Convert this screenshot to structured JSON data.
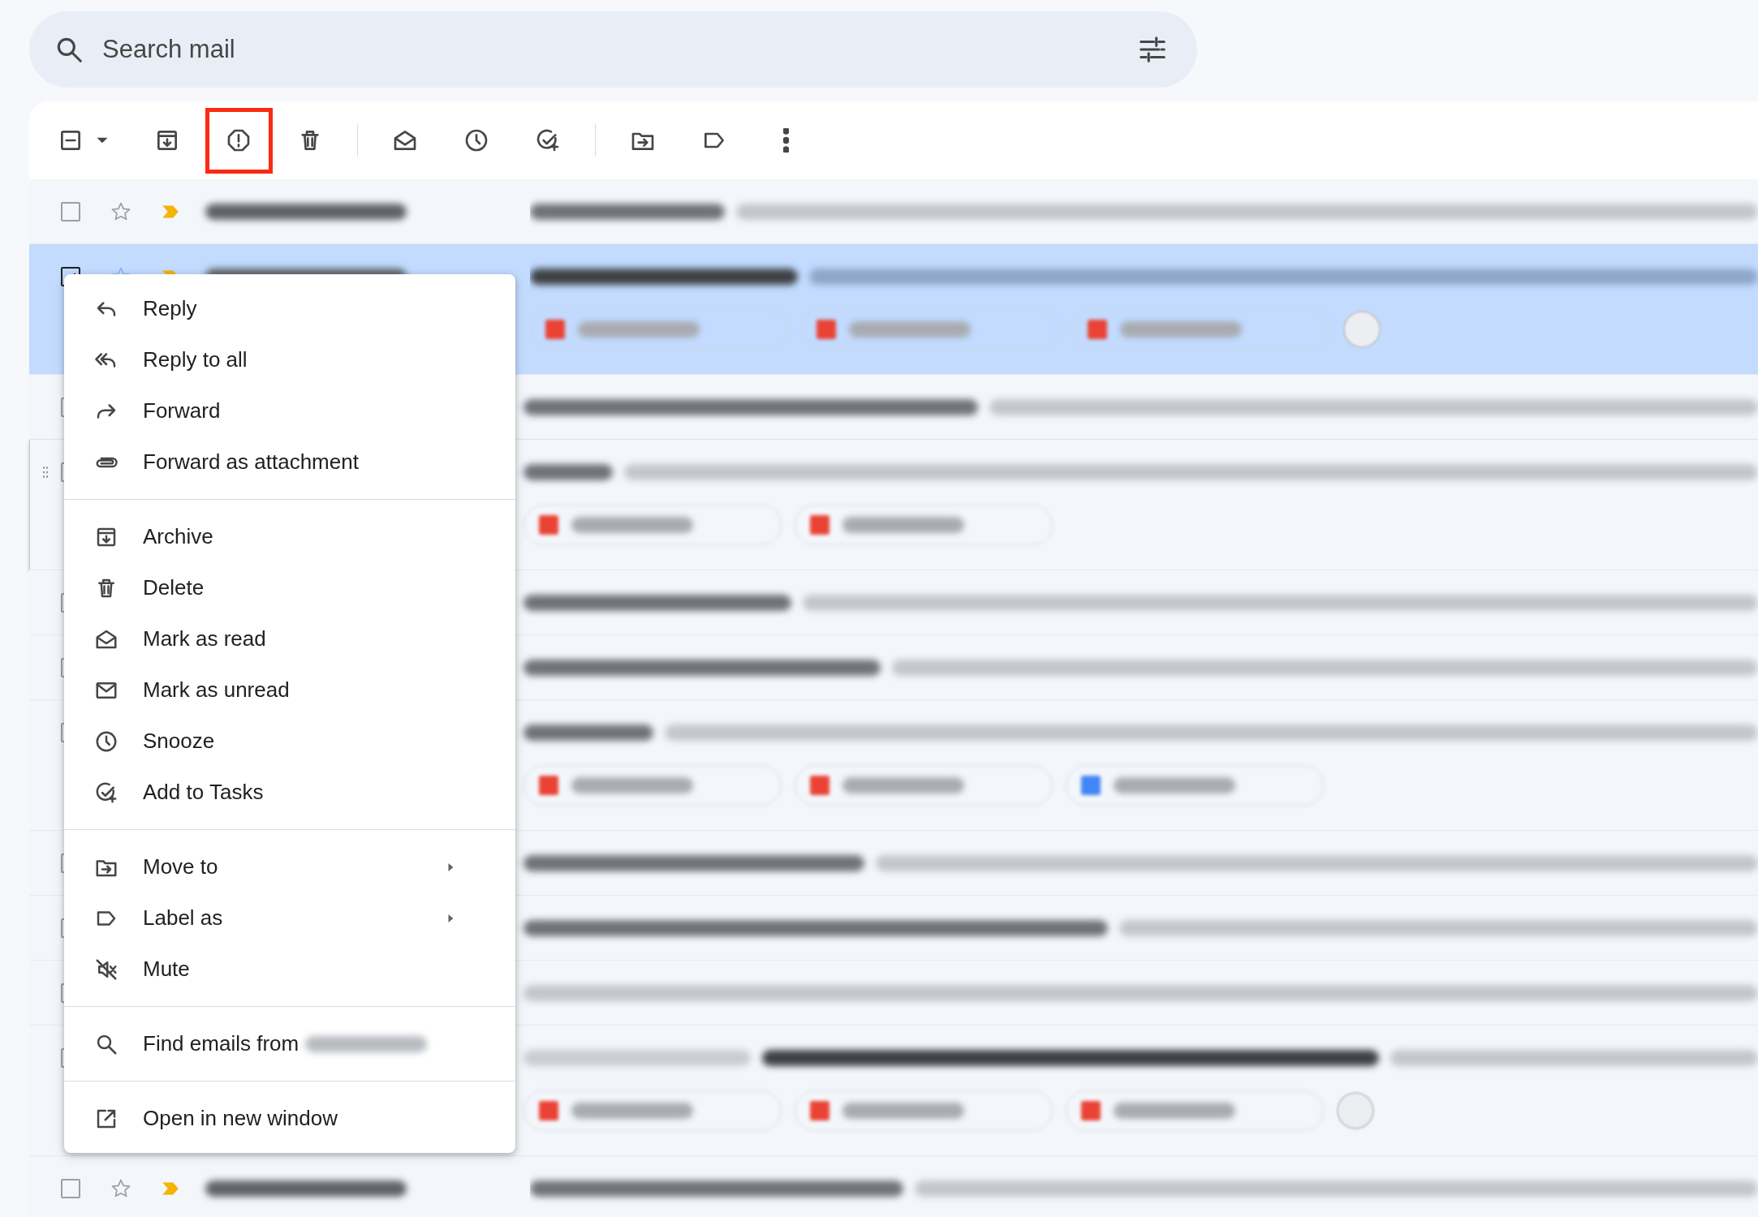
{
  "search": {
    "placeholder": "Search mail"
  },
  "toolbar": [
    {
      "kind": "select",
      "indeterminate": true
    },
    {
      "kind": "archive"
    },
    {
      "kind": "spam",
      "highlighted": true
    },
    {
      "kind": "delete"
    },
    {
      "kind": "divider"
    },
    {
      "kind": "mark-read"
    },
    {
      "kind": "snooze"
    },
    {
      "kind": "task"
    },
    {
      "kind": "divider"
    },
    {
      "kind": "move"
    },
    {
      "kind": "label"
    },
    {
      "kind": "more"
    }
  ],
  "rows": [
    {
      "selected": false,
      "checked": false,
      "starred": false,
      "important": true
    },
    {
      "selected": true,
      "checked": true,
      "starred": false,
      "important": true,
      "attachments": [
        {
          "color": "#ea4335"
        },
        {
          "color": "#ea4335"
        },
        {
          "color": "#ea4335"
        }
      ],
      "overflow": true
    },
    {
      "selected": false,
      "checked": false
    },
    {
      "selected": false,
      "checked": false,
      "hovered": true,
      "attachments": [
        {
          "color": "#ea4335"
        },
        {
          "color": "#ea4335"
        }
      ]
    },
    {
      "selected": false,
      "checked": false
    },
    {
      "selected": false,
      "checked": false
    },
    {
      "selected": false,
      "checked": false,
      "attachments": [
        {
          "color": "#ea4335"
        },
        {
          "color": "#ea4335"
        },
        {
          "color": "#4285f4"
        }
      ]
    },
    {
      "selected": false,
      "checked": false
    },
    {
      "selected": false,
      "checked": false
    },
    {
      "selected": false,
      "checked": false
    },
    {
      "selected": false,
      "checked": false,
      "tag": true,
      "attachments": [
        {
          "color": "#ea4335"
        },
        {
          "color": "#ea4335"
        },
        {
          "color": "#ea4335"
        }
      ],
      "overflow": true
    },
    {
      "selected": false,
      "checked": false,
      "starred": false,
      "important": true
    }
  ],
  "menu": {
    "groups": [
      [
        {
          "kind": "reply",
          "label": "Reply"
        },
        {
          "kind": "reply-all",
          "label": "Reply to all"
        },
        {
          "kind": "forward",
          "label": "Forward"
        },
        {
          "kind": "attach",
          "label": "Forward as attachment"
        }
      ],
      [
        {
          "kind": "archive",
          "label": "Archive"
        },
        {
          "kind": "delete",
          "label": "Delete"
        },
        {
          "kind": "mark-read",
          "label": "Mark as read"
        },
        {
          "kind": "mark-unread",
          "label": "Mark as unread"
        },
        {
          "kind": "snooze",
          "label": "Snooze"
        },
        {
          "kind": "task",
          "label": "Add to Tasks"
        }
      ],
      [
        {
          "kind": "move",
          "label": "Move to",
          "submenu": true
        },
        {
          "kind": "label",
          "label": "Label as",
          "submenu": true
        },
        {
          "kind": "mute",
          "label": "Mute",
          "submenu": false
        }
      ],
      [
        {
          "kind": "find",
          "label": "Find emails from",
          "redacted": true
        }
      ],
      [
        {
          "kind": "open-window",
          "label": "Open in new window"
        }
      ]
    ]
  }
}
